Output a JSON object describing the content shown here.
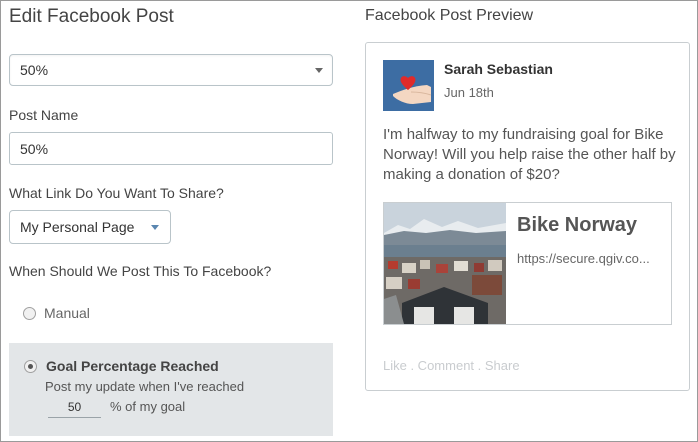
{
  "editor": {
    "title": "Edit Facebook Post",
    "post_select_value": "50%",
    "post_name_label": "Post Name",
    "post_name_value": "50%",
    "link_label": "What Link Do You Want To Share?",
    "link_select_value": "My Personal Page",
    "when_label": "When Should We Post This To Facebook?",
    "options": {
      "manual_label": "Manual",
      "goal_label": "Goal Percentage Reached",
      "goal_desc": "Post my update when I've reached",
      "goal_value": "50",
      "goal_suffix": "% of my goal"
    }
  },
  "preview": {
    "title": "Facebook Post Preview",
    "author": "Sarah Sebastian",
    "date": "Jun 18th",
    "message": "I'm halfway to my fundraising goal for Bike Norway! Will you help raise the other half by making a donation of $20?",
    "link_title": "Bike Norway",
    "link_url": "https://secure.qgiv.co...",
    "actions": "Like . Comment . Share"
  },
  "colors": {
    "accent": "#3d6da3",
    "heart": "#e02a2a",
    "panel_gray": "#e3e6e8"
  },
  "icons": {
    "select_caret": "chevron-down-icon",
    "avatar": "heart-in-hand-icon"
  }
}
